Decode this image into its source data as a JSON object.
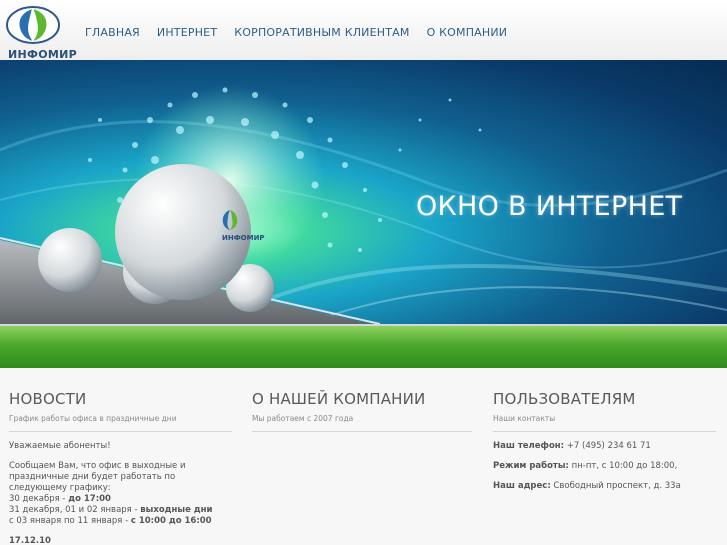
{
  "logo": {
    "text": "ИНФОМИР"
  },
  "nav": {
    "items": [
      "ГЛАВНАЯ",
      "ИНТЕРНЕТ",
      "КОРПОРАТИВНЫМ КЛИЕНТАМ",
      "О КОМПАНИИ"
    ]
  },
  "banner": {
    "title": "ОКНО В ИНТЕРНЕТ",
    "dome_logo_text": "ИНФОМИР"
  },
  "news": {
    "heading": "НОВОСТИ",
    "subtitle": "График работы офиса в праздничные дни",
    "greeting": "Уважаемые абоненты!",
    "intro": "Сообщаем Вам, что офис в выходные и праздничные дни будет работать по следующему графику:",
    "line1_text": "30 декабря - ",
    "line1_value": "до 17:00",
    "line2_text": "31 декабря, 01 и 02 января - ",
    "line2_value": "выходные дни",
    "line3_text": "с 03 января по 11 января - ",
    "line3_value": "с 10:00 до 16:00",
    "date": "17.12.10"
  },
  "about": {
    "heading": "О НАШЕЙ КОМПАНИИ",
    "subtitle": "Мы работаем с 2007 года"
  },
  "users": {
    "heading": "ПОЛЬЗОВАТЕЛЯМ",
    "subtitle": "Наши контакты",
    "phone_label": "Наш телефон:",
    "phone_value": " +7 (495) 234 61 71",
    "hours_label": "Режим работы:",
    "hours_value": " пн-пт, с 10:00 до 18:00,",
    "address_label": "Наш адрес:",
    "address_value": " Свободный проспект, д. 33а"
  },
  "colors": {
    "nav_link": "#2d5f86",
    "logo_blue": "#2a4f7a",
    "logo_green": "#5cb82e",
    "grass": "#4aa82c"
  }
}
